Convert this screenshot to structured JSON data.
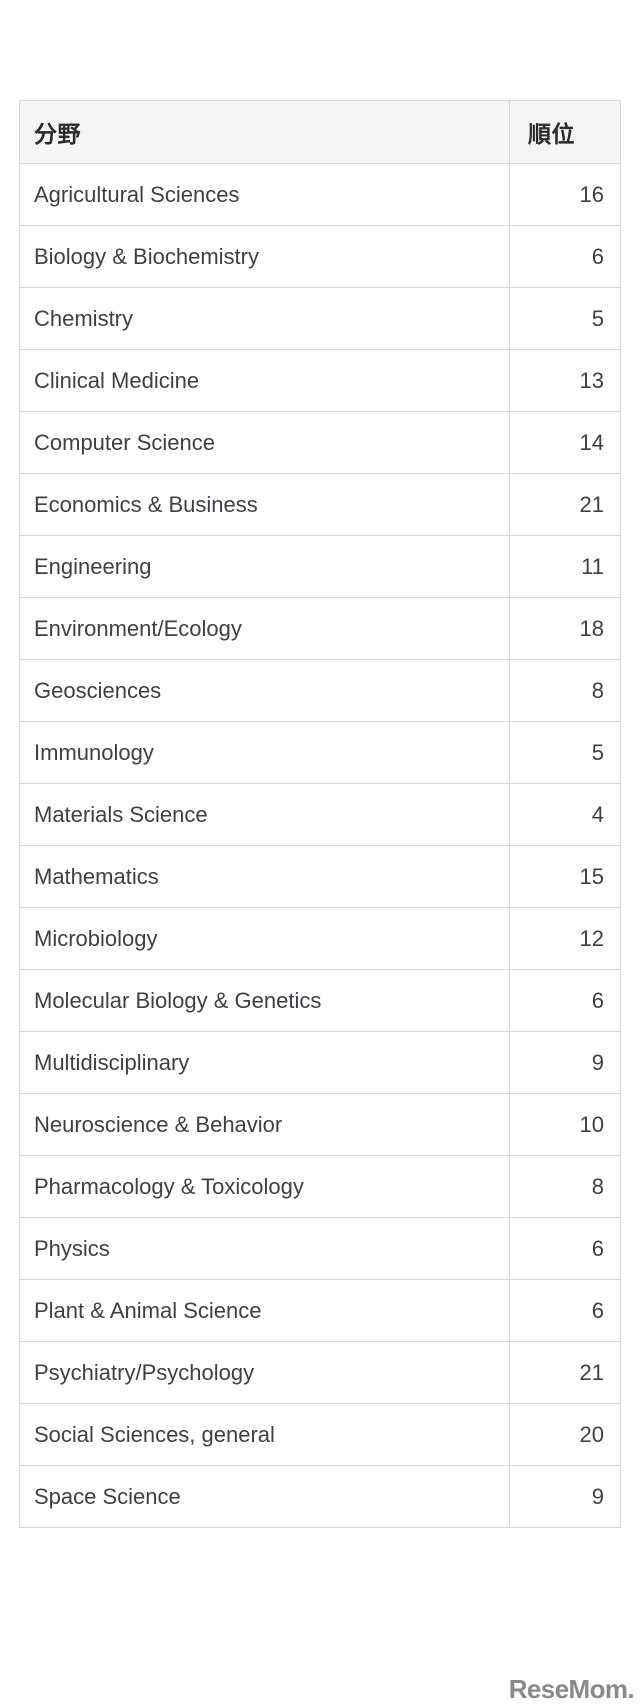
{
  "table": {
    "columns": [
      {
        "key": "field",
        "label": "分野",
        "align": "left"
      },
      {
        "key": "rank",
        "label": "順位",
        "align": "right"
      }
    ],
    "header": {
      "field_label": "分野",
      "rank_label": "順位"
    },
    "rows": [
      {
        "field": "Agricultural Sciences",
        "rank": "16"
      },
      {
        "field": "Biology & Biochemistry",
        "rank": "6"
      },
      {
        "field": "Chemistry",
        "rank": "5"
      },
      {
        "field": "Clinical Medicine",
        "rank": "13"
      },
      {
        "field": "Computer Science",
        "rank": "14"
      },
      {
        "field": "Economics & Business",
        "rank": "21"
      },
      {
        "field": "Engineering",
        "rank": "11"
      },
      {
        "field": "Environment/Ecology",
        "rank": "18"
      },
      {
        "field": "Geosciences",
        "rank": "8"
      },
      {
        "field": "Immunology",
        "rank": "5"
      },
      {
        "field": "Materials Science",
        "rank": "4"
      },
      {
        "field": "Mathematics",
        "rank": "15"
      },
      {
        "field": "Microbiology",
        "rank": "12"
      },
      {
        "field": "Molecular Biology & Genetics",
        "rank": "6"
      },
      {
        "field": "Multidisciplinary",
        "rank": "9"
      },
      {
        "field": "Neuroscience & Behavior",
        "rank": "10"
      },
      {
        "field": "Pharmacology & Toxicology",
        "rank": "8"
      },
      {
        "field": "Physics",
        "rank": "6"
      },
      {
        "field": "Plant & Animal Science",
        "rank": "6"
      },
      {
        "field": "Psychiatry/Psychology",
        "rank": "21"
      },
      {
        "field": "Social Sciences, general",
        "rank": "20"
      },
      {
        "field": "Space Science",
        "rank": "9"
      }
    ]
  },
  "watermark": {
    "text": "ReseMom",
    "dot": ".",
    "ticks": ""
  },
  "chart_data": {
    "type": "table",
    "title": "",
    "categories": [
      "Agricultural Sciences",
      "Biology & Biochemistry",
      "Chemistry",
      "Clinical Medicine",
      "Computer Science",
      "Economics & Business",
      "Engineering",
      "Environment/Ecology",
      "Geosciences",
      "Immunology",
      "Materials Science",
      "Mathematics",
      "Microbiology",
      "Molecular Biology & Genetics",
      "Multidisciplinary",
      "Neuroscience & Behavior",
      "Pharmacology & Toxicology",
      "Physics",
      "Plant & Animal Science",
      "Psychiatry/Psychology",
      "Social Sciences, general",
      "Space Science"
    ],
    "values": [
      16,
      6,
      5,
      13,
      14,
      21,
      11,
      18,
      8,
      5,
      4,
      15,
      12,
      6,
      9,
      10,
      8,
      6,
      6,
      21,
      20,
      9
    ],
    "xlabel": "分野",
    "ylabel": "順位"
  }
}
